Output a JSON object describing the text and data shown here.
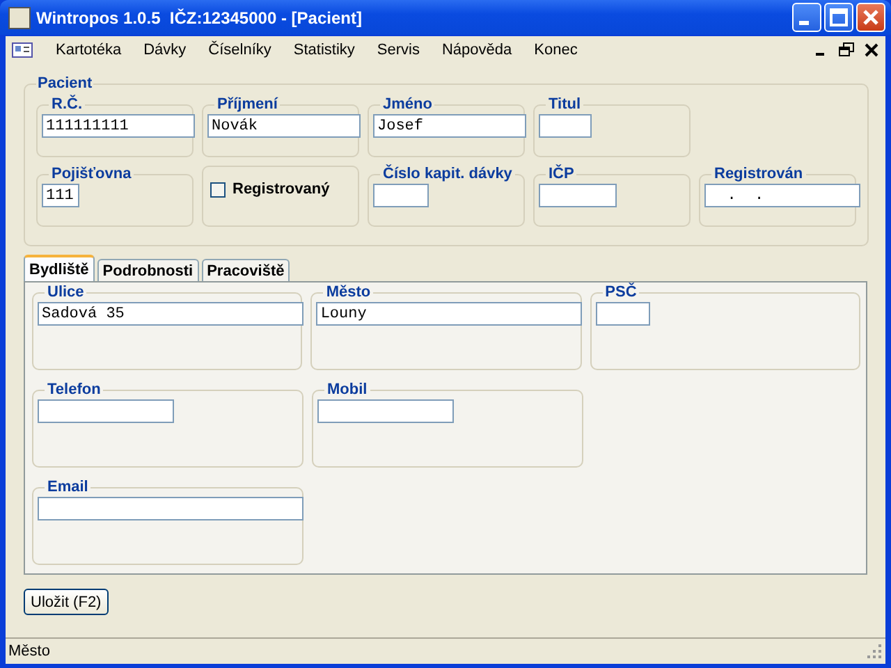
{
  "window": {
    "title": "Wintropos 1.0.5  IČZ:12345000 - [Pacient]"
  },
  "menu": [
    "Kartotéka",
    "Dávky",
    "Číselníky",
    "Statistiky",
    "Servis",
    "Nápověda",
    "Konec"
  ],
  "pacient": {
    "title": "Pacient",
    "rows": [
      [
        {
          "kind": "text",
          "label": "R.Č.",
          "value": "111111111"
        },
        {
          "kind": "text",
          "label": "Příjmení",
          "value": "Novák"
        },
        {
          "kind": "text",
          "label": "Jméno",
          "value": "Josef"
        },
        {
          "kind": "text",
          "label": "Titul"
        }
      ],
      [
        {
          "kind": "text",
          "label": "Pojišťovna",
          "value": "111"
        },
        {
          "kind": "checkbox",
          "label": "Registrovaný",
          "checked": false
        },
        {
          "kind": "text",
          "label": "Číslo kapit. dávky"
        },
        {
          "kind": "text",
          "label": "IČP"
        },
        {
          "kind": "text",
          "label": "Registrován",
          "value": "  .  ."
        }
      ]
    ]
  },
  "tabs": [
    {
      "label": "Bydliště",
      "selected": true
    },
    {
      "label": "Podrobnosti",
      "selected": false
    },
    {
      "label": "Pracoviště",
      "selected": false
    }
  ],
  "address": {
    "rows": [
      [
        {
          "kind": "text",
          "label": "Ulice",
          "value": "Sadová 35"
        },
        {
          "kind": "text",
          "label": "Město",
          "value": "Louny"
        },
        {
          "kind": "text",
          "label": "PSČ"
        }
      ],
      [
        {
          "kind": "text",
          "label": "Telefon"
        },
        {
          "kind": "text",
          "label": "Mobil"
        }
      ],
      [
        {
          "kind": "text",
          "label": "Email"
        }
      ]
    ]
  },
  "save_button": "Uložit (F2)",
  "status_bar": "Město"
}
